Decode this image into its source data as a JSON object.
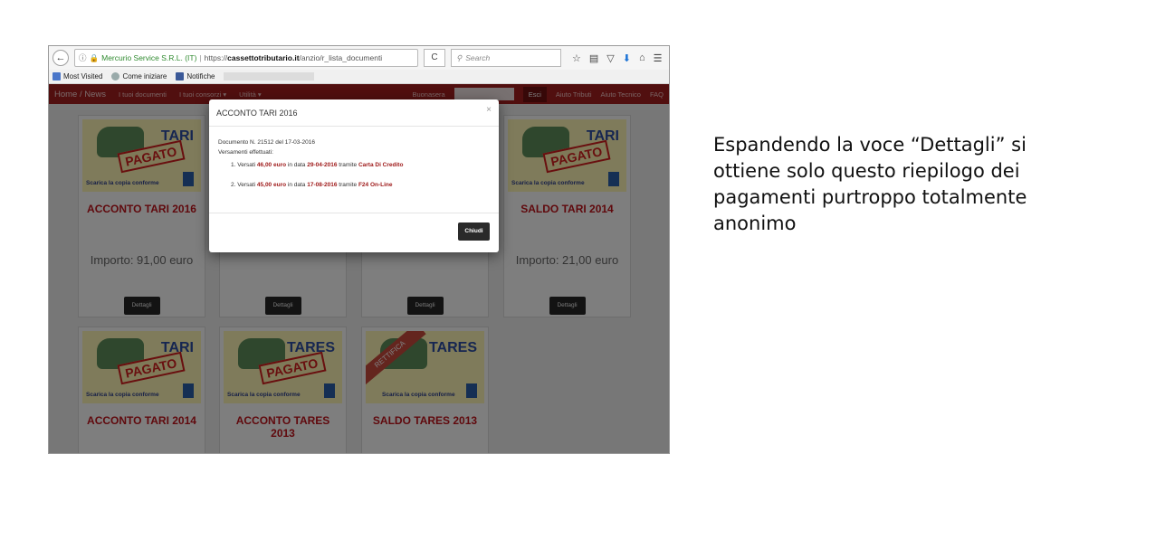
{
  "browser": {
    "back": "←",
    "info": "ⓘ",
    "lock": "🔒",
    "identity": "Mercurio Service S.R.L. (IT)",
    "url_scheme": "https://",
    "url_host": "cassettotributario.it",
    "url_path": "/anzio/r_lista_documenti",
    "reload": "C",
    "search_placeholder": "Search",
    "icons": [
      "star-icon",
      "clipboard-icon",
      "pocket-icon",
      "download-icon",
      "home-icon",
      "menu-icon"
    ]
  },
  "bookmarks": [
    {
      "label": "Most Visited",
      "icon": "bookmark-icon"
    },
    {
      "label": "Come iniziare",
      "icon": "globe-icon"
    },
    {
      "label": "Notifiche",
      "icon": "facebook-icon"
    }
  ],
  "site_nav": {
    "brand": "Home / News",
    "items": [
      "I tuoi documenti",
      "I tuoi consorzi ▾",
      "Utilità ▾"
    ],
    "welcome": "Buonasera",
    "logout": "Esci",
    "right_items": [
      "Aiuto Tributi",
      "Aiuto Tecnico",
      "FAQ"
    ]
  },
  "cards": [
    {
      "kind": "TARI",
      "stamp": "PAGATO",
      "download": "Scarica la copia conforme",
      "title": "ACCONTO TARI 2016",
      "amount": "Importo: 91,00 euro",
      "button": "Dettagli"
    },
    {
      "kind": "",
      "stamp": "",
      "download": "",
      "title": "",
      "amount": "",
      "button": "Dettagli"
    },
    {
      "kind": "",
      "stamp": "",
      "download": "",
      "title": "",
      "amount": "",
      "button": "Dettagli"
    },
    {
      "kind": "TARI",
      "stamp": "PAGATO",
      "download": "Scarica la copia conforme",
      "title": "SALDO TARI 2014",
      "amount": "Importo: 21,00 euro",
      "button": "Dettagli"
    },
    {
      "kind": "TARI",
      "stamp": "PAGATO",
      "download": "Scarica la copia conforme",
      "title": "ACCONTO TARI 2014",
      "amount": "",
      "button": ""
    },
    {
      "kind": "TARES",
      "stamp": "PAGATO",
      "download": "Scarica la copia conforme",
      "title": "ACCONTO TARES",
      "title2": "2013",
      "amount": "",
      "button": ""
    },
    {
      "kind": "TARES",
      "stamp": "",
      "ribbon": "RETTIFICA",
      "download": "Scarica la copia conforme",
      "title": "SALDO TARES 2013",
      "amount": "",
      "button": ""
    }
  ],
  "modal": {
    "title": "ACCONTO TARI 2016",
    "close": "×",
    "doc_line": "Documento N. 21512 del 17-03-2016",
    "payments_label": "Versamenti effettuati:",
    "payments": [
      {
        "prefix": "1. Versati ",
        "amount": "46,00 euro",
        "mid": " in data ",
        "date": "29-04-2016",
        "via": " tramite ",
        "method": "Carta Di Credito"
      },
      {
        "prefix": "2. Versati ",
        "amount": "45,00 euro",
        "mid": " in data ",
        "date": "17-08-2016",
        "via": " tramite ",
        "method": "F24 On-Line"
      }
    ],
    "button": "Chiudi"
  },
  "caption": {
    "lines": [
      "Espandendo la voce “Dettagli” si",
      "ottiene solo questo riepilogo dei",
      "pagamenti purtroppo totalmente",
      "anonimo"
    ]
  }
}
